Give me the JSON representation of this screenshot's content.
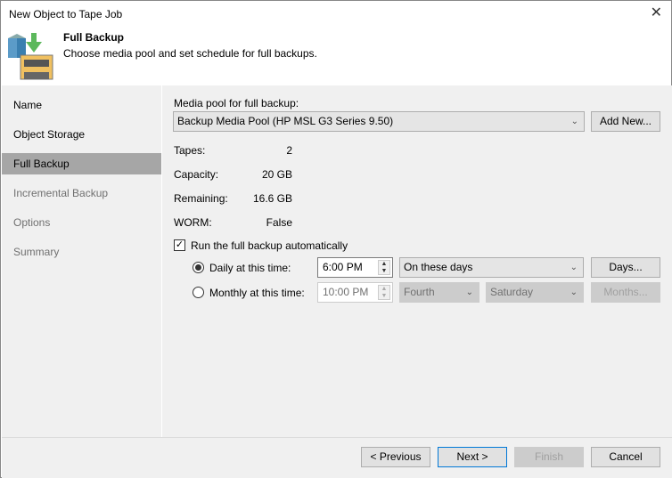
{
  "window": {
    "title": "New Object to Tape Job",
    "close": "✕"
  },
  "header": {
    "title": "Full Backup",
    "subtitle": "Choose media pool and set schedule for full backups."
  },
  "sidebar": {
    "items": [
      {
        "label": "Name"
      },
      {
        "label": "Object Storage"
      },
      {
        "label": "Full Backup"
      },
      {
        "label": "Incremental Backup"
      },
      {
        "label": "Options"
      },
      {
        "label": "Summary"
      }
    ]
  },
  "main": {
    "pool_label": "Media pool for full backup:",
    "pool_value": "Backup Media Pool (HP MSL G3 Series 9.50)",
    "add_new": "Add New...",
    "info": [
      {
        "label": "Tapes:",
        "value": "2"
      },
      {
        "label": "Capacity:",
        "value": "20 GB"
      },
      {
        "label": "Remaining:",
        "value": "16.6 GB"
      },
      {
        "label": "WORM:",
        "value": "False"
      }
    ],
    "run_auto_label": "Run the full backup automatically",
    "daily_label": "Daily at this time:",
    "daily_time": "6:00 PM",
    "daily_mode": "On these days",
    "days_button": "Days...",
    "monthly_label": "Monthly at this time:",
    "monthly_time": "10:00 PM",
    "monthly_week": "Fourth",
    "monthly_day": "Saturday",
    "months_button": "Months..."
  },
  "footer": {
    "previous": "< Previous",
    "next": "Next >",
    "finish": "Finish",
    "cancel": "Cancel"
  }
}
